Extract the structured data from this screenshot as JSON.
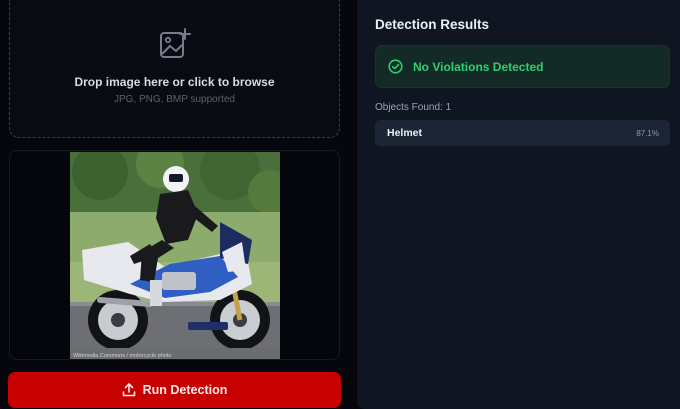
{
  "upload": {
    "icon": "image-add-icon",
    "title": "Drop image here or click to browse",
    "subtitle": "JPG, PNG, BMP supported"
  },
  "preview": {
    "image_subject": "motorcyclist-photo",
    "watermark": "Wikimedia Commons / motorcycle photo"
  },
  "actions": {
    "run_icon": "upload-icon",
    "run_label": "Run Detection"
  },
  "results": {
    "title": "Detection Results",
    "status_icon": "check-circle-icon",
    "status_text": "No Violations Detected",
    "objects_label": "Objects Found: 1",
    "objects": [
      {
        "name": "Helmet",
        "confidence": "87.1%"
      }
    ]
  },
  "colors": {
    "accent_red": "#c70000",
    "success_green": "#2ad26b",
    "panel_bg": "#101522"
  }
}
